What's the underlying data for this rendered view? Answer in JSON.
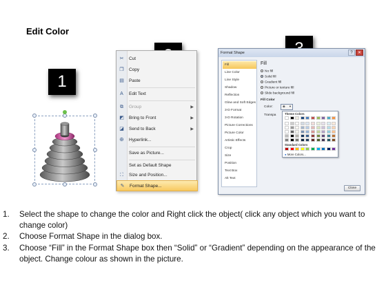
{
  "title": "Edit Color",
  "badges": [
    "1",
    "2",
    "3"
  ],
  "context_menu": {
    "items": [
      {
        "label": "Cut",
        "icon": "scissors-icon",
        "disabled": false
      },
      {
        "label": "Copy",
        "icon": "copy-icon",
        "disabled": false
      },
      {
        "label": "Paste",
        "icon": "paste-icon",
        "disabled": false
      },
      {
        "label": "Edit Text",
        "icon": "edit-text-icon",
        "disabled": false
      },
      {
        "label": "Group",
        "icon": "group-icon",
        "disabled": true,
        "submenu": true
      },
      {
        "label": "Bring to Front",
        "icon": "bring-front-icon",
        "disabled": false,
        "submenu": true
      },
      {
        "label": "Send to Back",
        "icon": "send-back-icon",
        "disabled": false,
        "submenu": true
      },
      {
        "label": "Hyperlink...",
        "icon": "hyperlink-icon",
        "disabled": false
      },
      {
        "label": "Save as Picture...",
        "icon": "",
        "disabled": false
      },
      {
        "label": "Set as Default Shape",
        "icon": "",
        "disabled": false
      },
      {
        "label": "Size and Position...",
        "icon": "size-icon",
        "disabled": false
      },
      {
        "label": "Format Shape...",
        "icon": "format-shape-icon",
        "disabled": false,
        "highlighted": true
      }
    ]
  },
  "dialog": {
    "title": "Format Shape",
    "controls": [
      "?",
      "✕"
    ],
    "categories": [
      "Fill",
      "Line Color",
      "Line Style",
      "Shadow",
      "Reflection",
      "Glow and Soft Edges",
      "3-D Format",
      "3-D Rotation",
      "Picture Corrections",
      "Picture Color",
      "Artistic Effects",
      "Crop",
      "Size",
      "Position",
      "Text Box",
      "Alt Text"
    ],
    "selected_category": "Fill",
    "fill_heading": "Fill",
    "fill_options": [
      "No fill",
      "Solid fill",
      "Gradient fill",
      "Picture or texture fill",
      "Slide background fill"
    ],
    "selected_fill": "Solid fill",
    "fill_color_label": "Fill Color",
    "color_label": "Color:",
    "transparency_label": "Transpa",
    "theme_colors_label": "Theme Colors",
    "standard_colors_label": "Standard Colors",
    "more_colors_label": "More Colors...",
    "close_label": "Close",
    "theme_top_row": [
      "#ffffff",
      "#000000",
      "#eeece1",
      "#1f497d",
      "#4f81bd",
      "#c0504d",
      "#9bbb59",
      "#8064a2",
      "#4bacc6",
      "#f79646"
    ],
    "standard_colors": [
      "#c00000",
      "#ff0000",
      "#ffc000",
      "#ffff00",
      "#92d050",
      "#00b050",
      "#00b0f0",
      "#0070c0",
      "#002060",
      "#7030a0"
    ]
  },
  "instructions": [
    {
      "num": "1.",
      "text": "Select the shape to change the color and Right click the object( click any object which you want to change color)"
    },
    {
      "num": "2.",
      "text": "Choose Format Shape in the dialog box."
    },
    {
      "num": "3.",
      "text": "Choose “Fill” in the Format Shape box then “Solid” or “Gradient” depending on the appearance of the object. Change colour as shown in the picture."
    }
  ]
}
